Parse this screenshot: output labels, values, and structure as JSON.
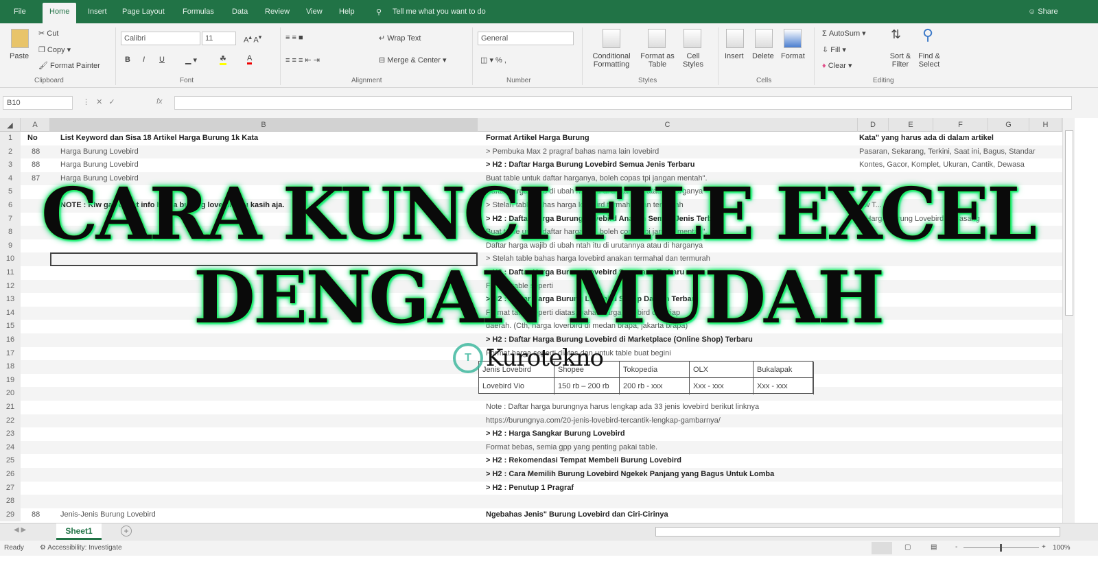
{
  "ribbon_tabs": [
    "File",
    "Home",
    "Insert",
    "Page Layout",
    "Formulas",
    "Data",
    "Review",
    "View",
    "Help"
  ],
  "tell_me": "Tell me what you want to do",
  "share": "Share",
  "clipboard": {
    "paste": "Paste",
    "cut": "Cut",
    "copy": "Copy",
    "format_painter": "Format Painter",
    "label": "Clipboard"
  },
  "font": {
    "name": "Calibri",
    "size": "11",
    "bold": "B",
    "italic": "I",
    "underline": "U",
    "label": "Font"
  },
  "alignment": {
    "wrap": "Wrap Text",
    "merge": "Merge & Center",
    "label": "Alignment"
  },
  "number": {
    "format": "General",
    "label": "Number"
  },
  "styles": {
    "conditional": "Conditional Formatting",
    "format_table": "Format as Table",
    "cell_styles": "Cell Styles",
    "label": "Styles"
  },
  "cells": {
    "insert": "Insert",
    "delete": "Delete",
    "format": "Format",
    "label": "Cells"
  },
  "editing": {
    "autosum": "AutoSum",
    "fill": "Fill",
    "clear": "Clear",
    "sort": "Sort & Filter",
    "find": "Find & Select",
    "label": "Editing"
  },
  "name_box": "B10",
  "fx": "fx",
  "columns": [
    "A",
    "B",
    "C",
    "D",
    "E",
    "F",
    "G",
    "H"
  ],
  "rows": [
    {
      "n": "1",
      "a": "No",
      "b": "List Keyword dan Sisa 18 Artikel Harga Burung 1k Kata",
      "c": "Format Artikel Harga Burung",
      "d": "Kata\" yang harus ada di dalam artikel",
      "bold": [
        "a",
        "b",
        "c",
        "d"
      ]
    },
    {
      "n": "2",
      "a": "88",
      "b": "Harga Burung Lovebird",
      "c": "> Pembuka Max 2 pragraf bahas nama lain lovebird",
      "d": "Pasaran, Sekarang, Terkini, Saat ini, Bagus, Standar"
    },
    {
      "n": "3",
      "a": "88",
      "b": "Harga Burung Lovebird",
      "c": "> H2 : Daftar Harga Burung Lovebird Semua Jenis Terbaru",
      "d": "Kontes, Gacor, Komplet, Ukuran, Cantik, Dewasa",
      "bold": [
        "c"
      ]
    },
    {
      "n": "4",
      "a": "87",
      "b": "Harga Burung Lovebird",
      "c": "Buat table untuk daftar harganya, boleh copas tpi jangan mentah\"."
    },
    {
      "n": "5",
      "c": "Daftar harga wajib di ubah ntah itu di urutannya atau di harganya"
    },
    {
      "n": "6",
      "b": "NOTE : Klw gak dapat info harga burung lovebird itu kasih aja.",
      "c": "> Stelah table bahas harga lovebird termahal dan termurah",
      "d": "Kw T...",
      "bold": [
        "b"
      ]
    },
    {
      "n": "7",
      "c": "> H2 : Daftar Harga Burung Lovebird Anakan Semua Jenis Terbaru",
      "d": "> Harga Burung Lovebird Sepasang",
      "bold": [
        "c"
      ]
    },
    {
      "n": "8",
      "c": "Buat table untuk daftar harganya, boleh copas tpi jangan mentah\"."
    },
    {
      "n": "9",
      "c": "Daftar harga wajib di ubah ntah itu di urutannya atau di harganya"
    },
    {
      "n": "10",
      "c": "> Stelah table bahas harga lovebird anakan termahal dan termurah"
    },
    {
      "n": "11",
      "c": "> H2 : Daftar Harga Burung Lovebird Sepasang Terbaru",
      "bold": [
        "c"
      ]
    },
    {
      "n": "12",
      "c": "Format table seperti"
    },
    {
      "n": "13",
      "c": "> H2 : Daftar Harga Burung Lovebird Setiap Daerah Terbaru",
      "bold": [
        "c"
      ]
    },
    {
      "n": "14",
      "c": "Format table seperti diatas, bahas harga lovebird di setiap"
    },
    {
      "n": "15",
      "c": "daerah. (Cth, harga loverbird di medan brapa, jakarta brapa)"
    },
    {
      "n": "16",
      "c": "> H2 : Daftar Harga Burung Lovebird di Marketplace (Online Shop) Terbaru",
      "bold": [
        "c"
      ]
    },
    {
      "n": "17",
      "c": "Format harga seperti diatas dan untuk table buat begini"
    },
    {
      "n": "18"
    },
    {
      "n": "19"
    },
    {
      "n": "20"
    },
    {
      "n": "21",
      "c": "Note : Daftar harga burungnya harus lengkap ada 33 jenis lovebird berikut linknya"
    },
    {
      "n": "22",
      "c": "https://burungnya.com/20-jenis-lovebird-tercantik-lengkap-gambarnya/"
    },
    {
      "n": "23",
      "c": "> H2 : Harga Sangkar Burung Lovebird",
      "bold": [
        "c"
      ]
    },
    {
      "n": "24",
      "c": "Format bebas, semia gpp yang penting pakai table."
    },
    {
      "n": "25",
      "c": "> H2 : Rekomendasi Tempat Membeli Burung Lovebird",
      "bold": [
        "c"
      ]
    },
    {
      "n": "26",
      "c": "> H2 : Cara Memilih Burung Lovebird Ngekek Panjang yang Bagus Untuk Lomba",
      "bold": [
        "c"
      ]
    },
    {
      "n": "27",
      "c": "> H2 : Penutup 1 Pragraf",
      "bold": [
        "c"
      ]
    },
    {
      "n": "28"
    },
    {
      "n": "29",
      "a": "88",
      "b": "Jenis-Jenis Burung Lovebird",
      "c": "Ngebahas Jenis\" Burung Lovebird dan Ciri-Cirinya",
      "bold": [
        "c"
      ]
    }
  ],
  "mini_table": {
    "headers": [
      "Jenis Lovebird",
      "Shopee",
      "Tokopedia",
      "OLX",
      "Bukalapak"
    ],
    "row": [
      "Lovebird Vio",
      "150 rb – 200 rb",
      "200 rb - xxx",
      "Xxx - xxx",
      "Xxx - xxx"
    ]
  },
  "overlay": {
    "line1": "CARA KUNCI FILE EXCEL",
    "line2": "DENGAN MUDAH"
  },
  "logo": {
    "text": "Kurotekno"
  },
  "sheet_tab": "Sheet1",
  "status": {
    "ready": "Ready",
    "accessibility": "Accessibility: Investigate",
    "zoom": "100%"
  },
  "colors": {
    "excel_green": "#217346",
    "overlay_glow": "#33ff66"
  }
}
